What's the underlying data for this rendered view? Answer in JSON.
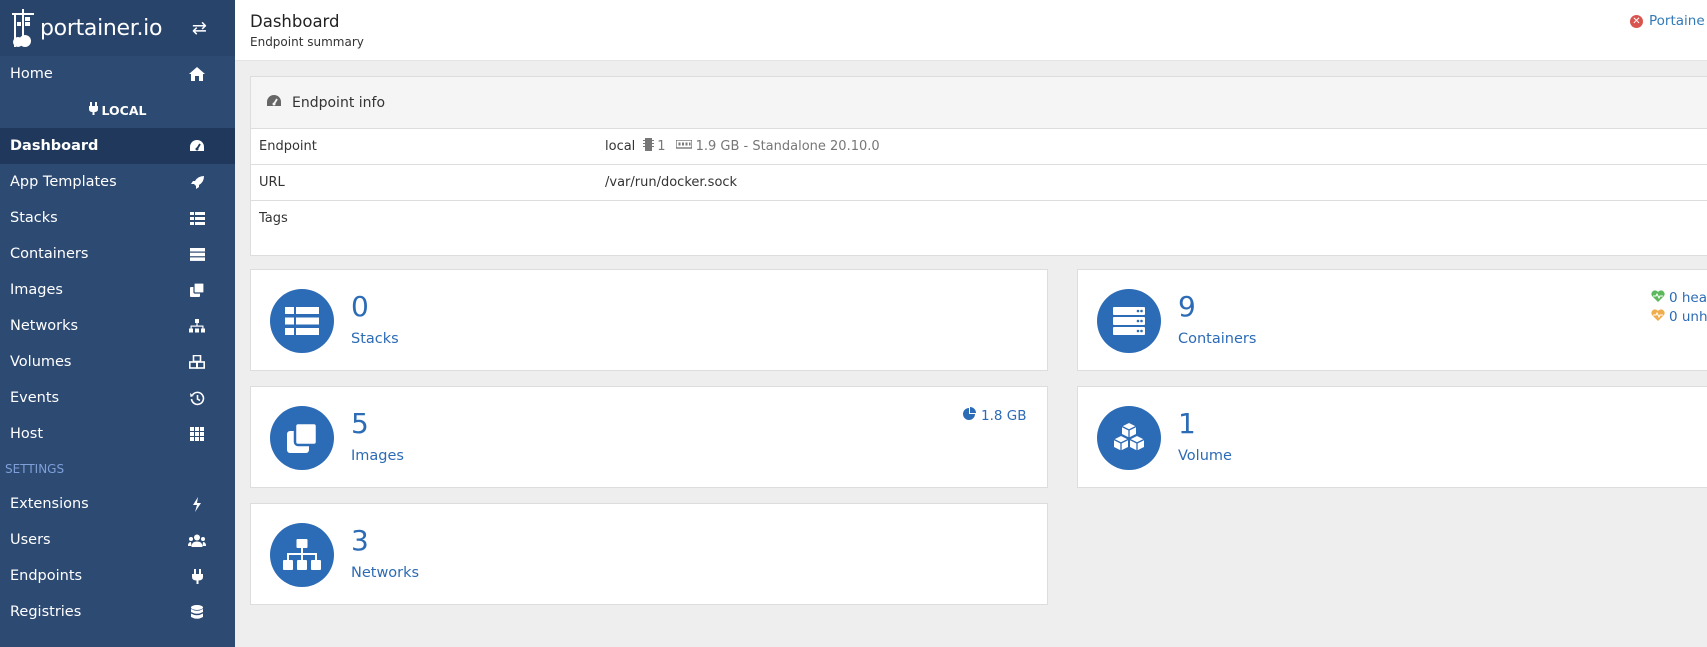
{
  "brand": {
    "name": "portainer.io"
  },
  "sidebar": {
    "home": "Home",
    "endpoint_label": "LOCAL",
    "items": [
      {
        "label": "Dashboard",
        "icon": "tachometer-icon"
      },
      {
        "label": "App Templates",
        "icon": "rocket-icon"
      },
      {
        "label": "Stacks",
        "icon": "list-icon"
      },
      {
        "label": "Containers",
        "icon": "server-icon"
      },
      {
        "label": "Images",
        "icon": "clone-icon"
      },
      {
        "label": "Networks",
        "icon": "sitemap-icon"
      },
      {
        "label": "Volumes",
        "icon": "cubes-icon"
      },
      {
        "label": "Events",
        "icon": "history-icon"
      },
      {
        "label": "Host",
        "icon": "th-icon"
      }
    ],
    "settings_header": "SETTINGS",
    "settings_items": [
      {
        "label": "Extensions",
        "icon": "bolt-icon"
      },
      {
        "label": "Users",
        "icon": "users-icon"
      },
      {
        "label": "Endpoints",
        "icon": "plug-icon"
      },
      {
        "label": "Registries",
        "icon": "database-icon"
      }
    ]
  },
  "header": {
    "title": "Dashboard",
    "subtitle": "Endpoint summary",
    "right_link": "Portaine"
  },
  "endpoint_info": {
    "title": "Endpoint info",
    "rows": [
      {
        "key": "Endpoint"
      },
      {
        "key": "URL",
        "value": "/var/run/docker.sock"
      },
      {
        "key": "Tags",
        "value": ""
      }
    ],
    "endpoint_name": "local",
    "cpu": "1",
    "memory_mode": "1.9 GB - Standalone 20.10.0"
  },
  "cards": {
    "stacks": {
      "count": "0",
      "label": "Stacks"
    },
    "containers": {
      "count": "9",
      "label": "Containers",
      "healthy": "0 hea",
      "unhealthy": "0 unh"
    },
    "images": {
      "count": "5",
      "label": "Images",
      "size": "1.8 GB"
    },
    "volumes": {
      "count": "1",
      "label": "Volume"
    },
    "networks": {
      "count": "3",
      "label": "Networks"
    }
  },
  "colors": {
    "sidebar": "#2d4a73",
    "accent": "#2c6bb5",
    "danger": "#d9534f",
    "healthy": "#5cb85c",
    "unhealthy": "#f0ad4e"
  }
}
